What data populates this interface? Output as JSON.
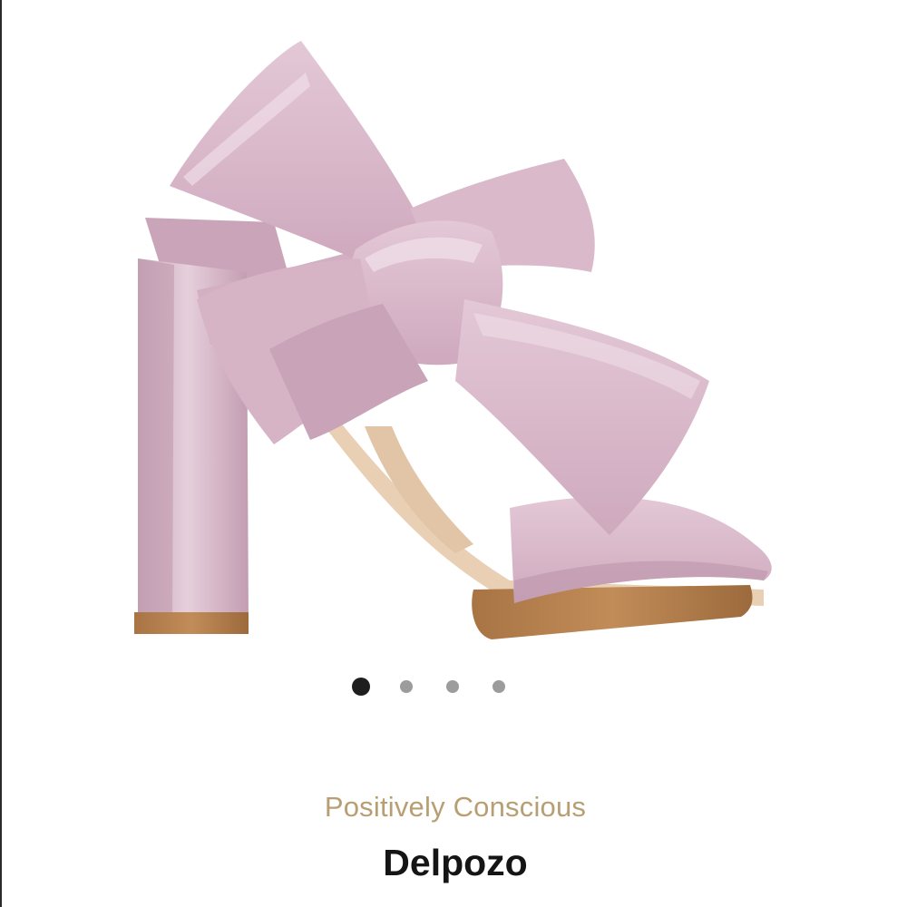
{
  "product": {
    "eyebrow": "Positively Conscious",
    "brand": "Delpozo",
    "name_partial": "",
    "image": {
      "subject": "pink-bow-block-heel-sandal",
      "colors": {
        "leather": "#d6b4c6",
        "leather_shadow": "#bd96ac",
        "sole": "#b88250"
      }
    }
  },
  "carousel": {
    "total": 4,
    "active_index": 1
  },
  "colors": {
    "eyebrow": "#b79f73",
    "dot_active": "#1e1e1e",
    "dot_inactive": "#9c9c9c"
  }
}
